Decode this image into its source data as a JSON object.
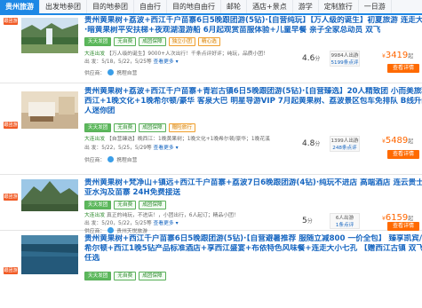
{
  "nav": {
    "items": [
      "贵州旅游",
      "出发地参团",
      "目的地参团",
      "自由行",
      "目的地自由行",
      "邮轮",
      "酒店+景点",
      "游学",
      "定制旅行",
      "一日游"
    ],
    "active_index": 0
  },
  "products": [
    {
      "side_tag": "跟团游",
      "title": "贵州黄果树+荔波+西江千户苗寨6日5晚跟团游(5钻)·【自营纯玩】【万人级的诞生】初夏旅游 连走大小七孔",
      "title_line2": "·暗黄果树平安扶梯+夜观湖湿游船 6月起观赏苗服体验+儿童早餐 亲子全家总动员 双飞",
      "tags": [
        "天天发团",
        "无自费",
        "成团保障",
        "独立小团",
        "精心选"
      ],
      "line1": "【万人级的诞生】9000+人次出行！千条点评好评；纯玩，品质小团！",
      "line1_label": "大连出发",
      "line2": "出 发：5/18，5/22，5/25等",
      "line2_link": "查看更多",
      "supplier": "供应商：",
      "supplier_name": "携程自营",
      "score": "4.6",
      "score_unit": "分",
      "orders_count": "9984人出游",
      "orders_link": "5199条点评",
      "price": "3419",
      "price_prefix": "¥",
      "price_suffix": "起"
    },
    {
      "side_tag": "跟团游",
      "title": "贵州黄果树+荔波+西江千户苗寨+青岩古镇6日5晚跟团游(5钻)·【自营臻选】20人精致团 小而美旅程 1晚",
      "title_line2": "西江+1晚文化+1晚希尔顿/豪华 客泉大巴 明星导游VIP 7月起黄果树、荔波景区包车免排队 B线升级12",
      "title_line3": "人迷你团",
      "tags": [
        "天天发团",
        "无自费",
        "成团保障",
        "赠险旅行"
      ],
      "line1": "【自营臻选】晚西江：1晚黄果树；1晚文化+1晚希尔顿/豪华；1晚花溪",
      "line1_label": "大连出发",
      "line2": "出 发：5/22，5/25，5/29等",
      "line2_link": "查看更多",
      "supplier": "供应商：",
      "supplier_name": "携程自营",
      "score": "4.8",
      "score_unit": "分",
      "orders_count": "1399人出游",
      "orders_link": "248条点评",
      "price": "5489",
      "price_prefix": "¥",
      "price_suffix": "起"
    },
    {
      "side_tag": "跟团游",
      "title": "贵州黄果树+梵净山+镇远+西江千户苗寨+荔波7日6晚跟团游(4钻)·纯玩不进店 高端酒店 连云贵士家村及",
      "title_line2": "亚水沟及苗寨 24H免费接送",
      "tags": [
        "天天发团",
        "无自费",
        "成团保障"
      ],
      "line1": "真正的纯玩，不进店！，小团出行，6人起订；精品小团！",
      "line1_label": "大连出发",
      "line2": "出 发：5/20，5/22，5/25等",
      "line2_link": "查看更多",
      "supplier": "供应商：",
      "supplier_name": "贵州天悦旅游",
      "score": "5",
      "score_unit": "分",
      "orders_count": "6人出游",
      "orders_link": "1条点评",
      "price": "6159",
      "price_prefix": "¥",
      "price_suffix": "起"
    },
    {
      "side_tag": "跟团游",
      "title": "贵州黄果树+西江千户苗寨6日5晚跟团游(5钻)·【自营避暑推荐 服随立减800 一价全包】 臻享凯宾/",
      "title_line2": "希尔顿+西江1晚5钻产品标准酒店+享西江盛宴+布依特色风味餐+连走大小七孔 【赠西江古镇 双飞",
      "title_line3": "任选",
      "tags": [
        "天天发团",
        "无自费",
        "成团保障"
      ],
      "line1": "",
      "line1_label": "",
      "line2": "",
      "line2_link": "",
      "supplier": "",
      "supplier_name": "",
      "score": "",
      "score_unit": "",
      "orders_count": "",
      "orders_link": "",
      "price": "",
      "price_prefix": "",
      "price_suffix": ""
    }
  ],
  "buttons": {
    "book": "查看详情"
  },
  "colors": {
    "primary": "#1e88e5",
    "link": "#1565c0",
    "price": "#ff6600",
    "tag_green": "#5cb85c",
    "side_tag": "#f15a24"
  }
}
